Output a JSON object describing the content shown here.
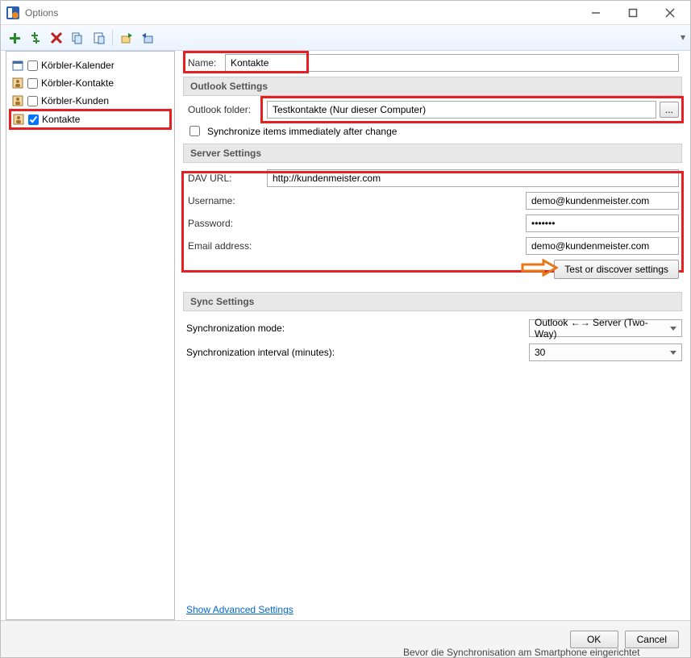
{
  "window": {
    "title": "Options"
  },
  "toolbar_icons": [
    "add",
    "add2",
    "delete",
    "copy",
    "paste",
    "separator",
    "export",
    "import"
  ],
  "tree": {
    "items": [
      {
        "label": "Körbler-Kalender",
        "checked": false,
        "icon": "calendar"
      },
      {
        "label": "Körbler-Kontakte",
        "checked": false,
        "icon": "contacts"
      },
      {
        "label": "Körbler-Kunden",
        "checked": false,
        "icon": "contacts"
      },
      {
        "label": "Kontakte",
        "checked": true,
        "icon": "contacts",
        "highlighted": true
      }
    ]
  },
  "name_row": {
    "label": "Name:",
    "value": "Kontakte"
  },
  "outlook_section": {
    "title": "Outlook Settings",
    "folder_label": "Outlook folder:",
    "folder_value": "Testkontakte (Nur dieser Computer)",
    "browse_button": "...",
    "sync_immediate_label": "Synchronize items immediately after change",
    "sync_immediate_checked": false
  },
  "server_section": {
    "title": "Server Settings",
    "dav_label": "DAV URL:",
    "dav_value": "http://kundenmeister.com",
    "user_label": "Username:",
    "user_value": "demo@kundenmeister.com",
    "pass_label": "Password:",
    "pass_value": "*******",
    "email_label": "Email address:",
    "email_value": "demo@kundenmeister.com",
    "test_button": "Test or discover settings"
  },
  "sync_section": {
    "title": "Sync Settings",
    "mode_label": "Synchronization mode:",
    "mode_value": "Outlook ←→ Server (Two-Way)",
    "interval_label": "Synchronization interval (minutes):",
    "interval_value": "30"
  },
  "advanced_link": "Show Advanced Settings",
  "footer": {
    "ok": "OK",
    "cancel": "Cancel"
  },
  "background_text": {
    "bottom": "Bevor die Synchronisation am Smartphone eingerichtet"
  }
}
